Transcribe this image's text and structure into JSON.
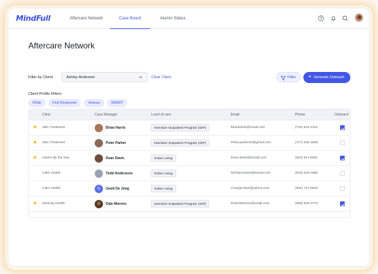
{
  "app": {
    "logo": "MindFull"
  },
  "nav": {
    "tabs": [
      {
        "label": "Aftercare Network",
        "active": false
      },
      {
        "label": "Case Board",
        "active": true
      },
      {
        "label": "Alumni Status",
        "active": false
      }
    ],
    "icons": [
      "help-icon",
      "bell-icon",
      "search-icon",
      "user-avatar"
    ]
  },
  "page": {
    "title": "Aftercare Network"
  },
  "filters": {
    "client_label": "Filter by Client:",
    "client_value": "Ashley Anderson",
    "clear_label": "Clear Client",
    "filter_button": "Filter",
    "generate_button": "Generate Outreach",
    "profile_label": "Client Profile Filters:",
    "chips": [
      "White",
      "First Responder",
      "Veteran",
      "SMART"
    ]
  },
  "table": {
    "headers": [
      "Clinic",
      "Case Manager",
      "Level of care",
      "Email",
      "Phone",
      "Outreach"
    ],
    "rows": [
      {
        "starred": true,
        "clinic": "ABC Treatment",
        "manager": "Brian Harris",
        "avatar_initial": "",
        "avatar_color": "#a9765c",
        "care": "Intensive Outpatient Program (IOP)",
        "email": "brianharris@email.com",
        "phone": "(719) 814-1414",
        "outreach": true
      },
      {
        "starred": true,
        "clinic": "ABC Treatment",
        "manager": "Peter Parker",
        "avatar_initial": "",
        "avatar_color": "#8b6a55",
        "care": "Intensive Outpatient Program (IOP)",
        "email": "Peter.parker44@gmail.com",
        "phone": "(717) 634-1806",
        "outreach": false
      },
      {
        "starred": true,
        "clinic": "Lakers By the Sea",
        "manager": "Dean Davis",
        "avatar_initial": "",
        "avatar_color": "#6e4f3d",
        "care": "Sober Living",
        "email": "Dean.Davis@email.com",
        "phone": "(610) 517-8251",
        "outreach": true
      },
      {
        "starred": false,
        "clinic": "Calm Health",
        "manager": "Todd Andersons",
        "avatar_initial": "",
        "avatar_color": "#9aa3b5",
        "care": "Sober Living",
        "email": "Richard.Davis@emaw.com",
        "phone": "(916) 619-1856",
        "outreach": false
      },
      {
        "starred": false,
        "clinic": "Calm Health",
        "manager": "Geett De Jong",
        "avatar_initial": "G",
        "avatar_color": "#5b6ee8",
        "care": "Sober Living",
        "email": "Crainge.Man@yahoo.com",
        "phone": "(504) 717-6620",
        "outreach": false
      },
      {
        "starred": true,
        "clinic": "Serenity Health",
        "manager": "Dale Moreno",
        "avatar_initial": "D",
        "avatar_color": "#5a3a1e",
        "care": "Intensive Outpatient Program (IOP)",
        "email": "PedroMoreno@email.com",
        "phone": "(656) 594-2774",
        "outreach": true
      }
    ]
  },
  "colors": {
    "accent": "#4257e6",
    "star": "#f5b91e"
  }
}
